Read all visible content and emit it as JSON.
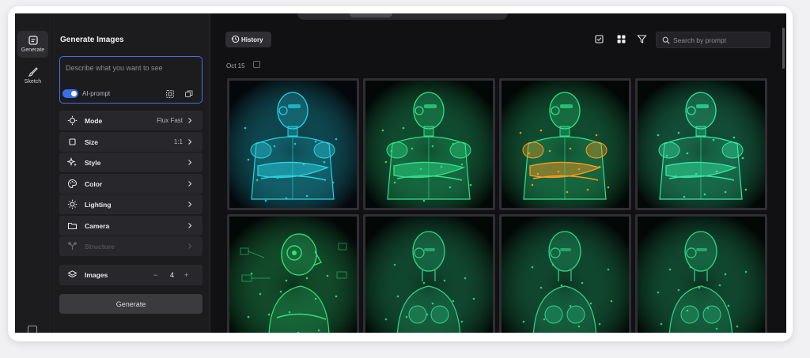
{
  "rail": {
    "items": [
      {
        "label": "Generate",
        "icon": "generate-icon",
        "active": true
      },
      {
        "label": "Sketch",
        "icon": "brush-icon",
        "active": false
      }
    ]
  },
  "panel": {
    "title": "Generate Images",
    "prompt_placeholder": "Describe what you want to see",
    "ai_prompt_label": "AI-prompt",
    "ai_prompt_enabled": true,
    "settings": [
      {
        "label": "Mode",
        "value": "Flux Fast",
        "icon": "mode-icon"
      },
      {
        "label": "Size",
        "value": "1:1",
        "icon": "size-icon"
      },
      {
        "label": "Style",
        "value": "",
        "icon": "style-icon"
      },
      {
        "label": "Color",
        "value": "",
        "icon": "palette-icon"
      },
      {
        "label": "Lighting",
        "value": "",
        "icon": "lighting-icon"
      },
      {
        "label": "Camera",
        "value": "",
        "icon": "camera-icon"
      },
      {
        "label": "Structure",
        "value": "",
        "icon": "structure-icon",
        "disabled": true
      }
    ],
    "images": {
      "label": "Images",
      "minus": "−",
      "value": "4",
      "plus": "+"
    },
    "generate_label": "Generate"
  },
  "main": {
    "history_label": "History",
    "search_placeholder": "Search by prompt",
    "date_label": "Oct 15",
    "tiles": [
      {
        "glow": "#27d3e6",
        "accent": "#27d3e6",
        "pose": "arms-crossed"
      },
      {
        "glow": "#2fe38a",
        "accent": "#2fe38a",
        "pose": "arms-crossed"
      },
      {
        "glow": "#2fe38a",
        "accent": "#ff9a1f",
        "pose": "arms-crossed"
      },
      {
        "glow": "#35e8a4",
        "accent": "#35e8a4",
        "pose": "arms-crossed"
      },
      {
        "glow": "#33e07a",
        "accent": "#33e07a",
        "pose": "profile"
      },
      {
        "glow": "#2fd58a",
        "accent": "#2fd58a",
        "pose": "bust"
      },
      {
        "glow": "#2fd58a",
        "accent": "#2fd58a",
        "pose": "bust"
      },
      {
        "glow": "#2fd58a",
        "accent": "#2fd58a",
        "pose": "bust"
      }
    ]
  },
  "colors": {
    "accent_blue": "#3a6ee8",
    "panel_bg": "#1c1c1f",
    "main_bg": "#111113"
  }
}
